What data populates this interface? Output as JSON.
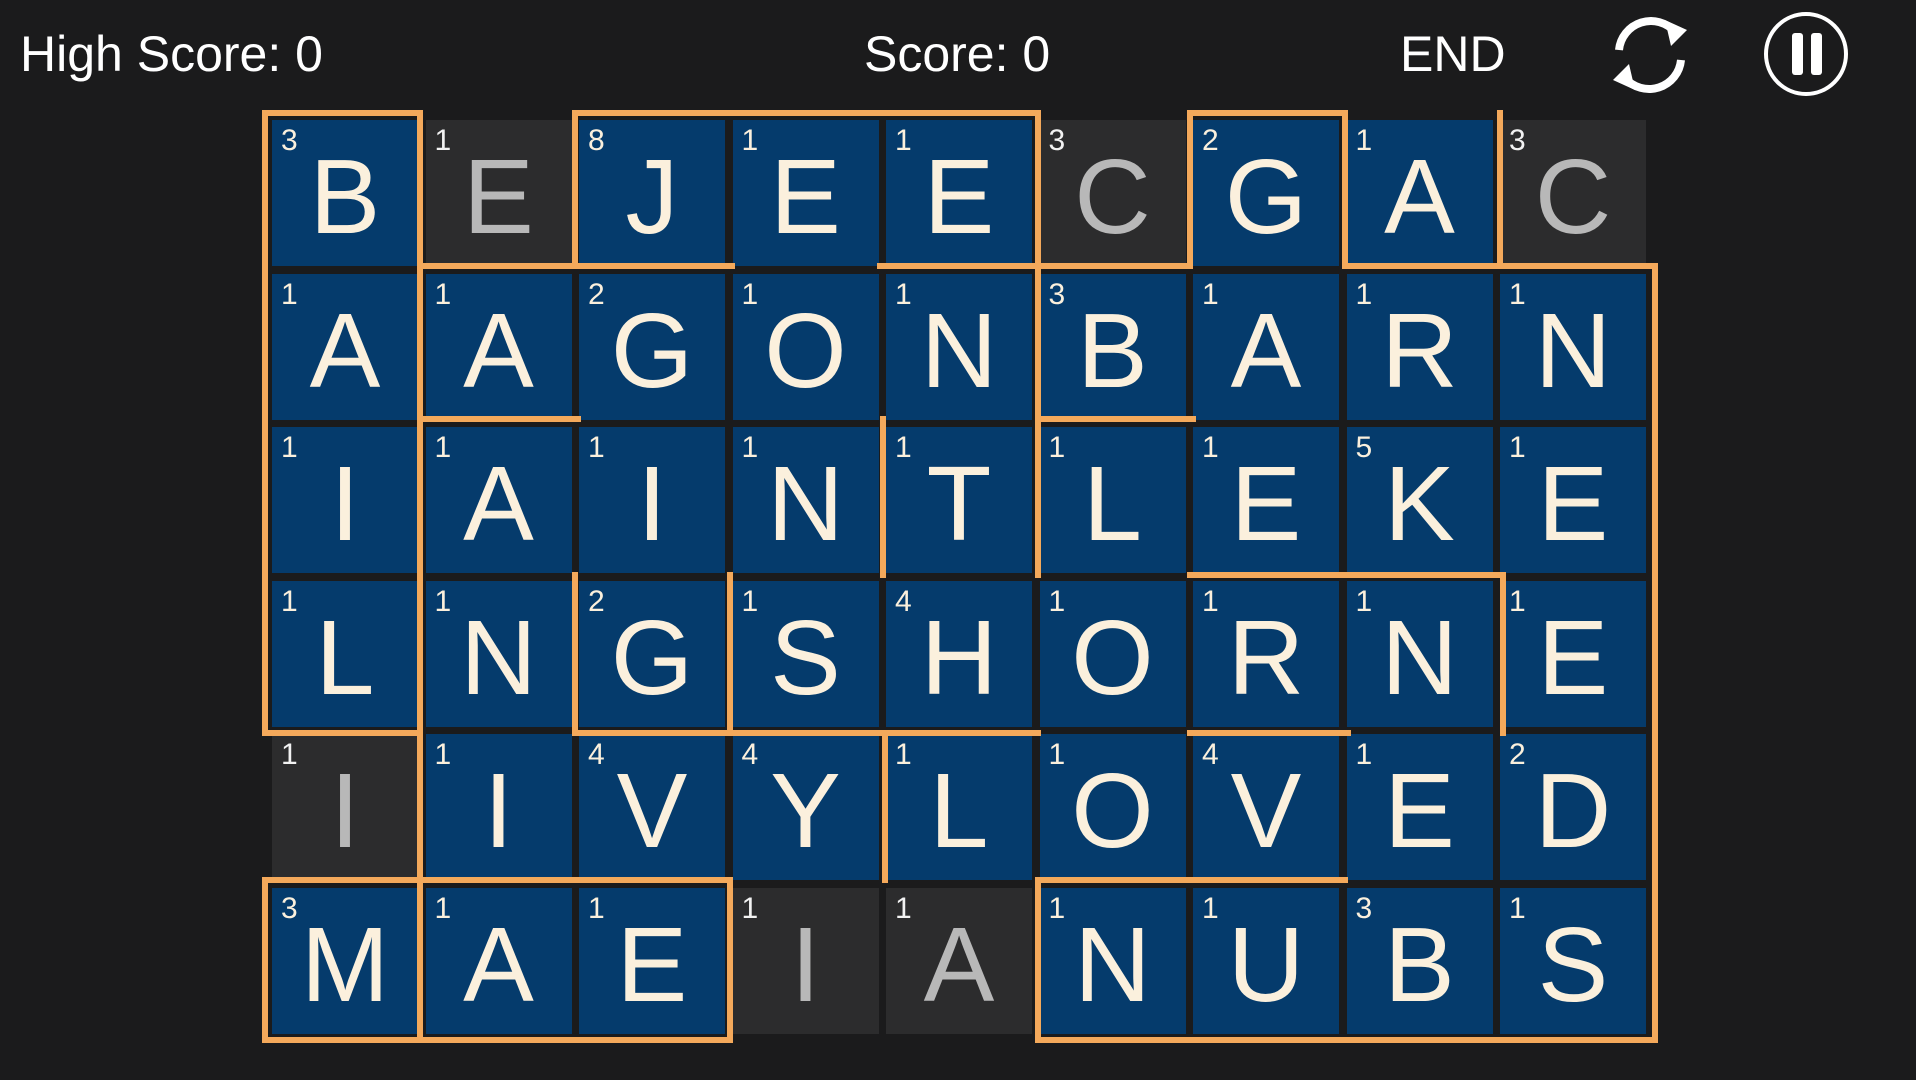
{
  "hud": {
    "high_score_label": "High Score: 0",
    "score_label": "Score: 0",
    "end_label": "END",
    "restart_icon": "restart-icon",
    "pause_icon": "pause-icon"
  },
  "colors": {
    "background": "#1b1b1c",
    "tile_blue": "#053b6c",
    "tile_dark": "#2c2c2d",
    "wall": "#f4a95b",
    "letter_light": "#fbf0dd",
    "letter_gray": "#b8b8b8"
  },
  "board": {
    "rows": [
      [
        {
          "letter": "B",
          "value": "3",
          "style": "blue"
        },
        {
          "letter": "E",
          "value": "1",
          "style": "dark"
        },
        {
          "letter": "J",
          "value": "8",
          "style": "blue"
        },
        {
          "letter": "E",
          "value": "1",
          "style": "blue"
        },
        {
          "letter": "E",
          "value": "1",
          "style": "blue"
        },
        {
          "letter": "C",
          "value": "3",
          "style": "dark"
        },
        {
          "letter": "G",
          "value": "2",
          "style": "blue"
        },
        {
          "letter": "A",
          "value": "1",
          "style": "blue"
        },
        {
          "letter": "C",
          "value": "3",
          "style": "dark"
        }
      ],
      [
        {
          "letter": "A",
          "value": "1",
          "style": "blue"
        },
        {
          "letter": "A",
          "value": "1",
          "style": "blue"
        },
        {
          "letter": "G",
          "value": "2",
          "style": "blue"
        },
        {
          "letter": "O",
          "value": "1",
          "style": "blue"
        },
        {
          "letter": "N",
          "value": "1",
          "style": "blue"
        },
        {
          "letter": "B",
          "value": "3",
          "style": "blue"
        },
        {
          "letter": "A",
          "value": "1",
          "style": "blue"
        },
        {
          "letter": "R",
          "value": "1",
          "style": "blue"
        },
        {
          "letter": "N",
          "value": "1",
          "style": "blue"
        }
      ],
      [
        {
          "letter": "I",
          "value": "1",
          "style": "blue"
        },
        {
          "letter": "A",
          "value": "1",
          "style": "blue"
        },
        {
          "letter": "I",
          "value": "1",
          "style": "blue"
        },
        {
          "letter": "N",
          "value": "1",
          "style": "blue"
        },
        {
          "letter": "T",
          "value": "1",
          "style": "blue"
        },
        {
          "letter": "L",
          "value": "1",
          "style": "blue"
        },
        {
          "letter": "E",
          "value": "1",
          "style": "blue"
        },
        {
          "letter": "K",
          "value": "5",
          "style": "blue"
        },
        {
          "letter": "E",
          "value": "1",
          "style": "blue"
        }
      ],
      [
        {
          "letter": "L",
          "value": "1",
          "style": "blue"
        },
        {
          "letter": "N",
          "value": "1",
          "style": "blue"
        },
        {
          "letter": "G",
          "value": "2",
          "style": "blue"
        },
        {
          "letter": "S",
          "value": "1",
          "style": "blue"
        },
        {
          "letter": "H",
          "value": "4",
          "style": "blue"
        },
        {
          "letter": "O",
          "value": "1",
          "style": "blue"
        },
        {
          "letter": "R",
          "value": "1",
          "style": "blue"
        },
        {
          "letter": "N",
          "value": "1",
          "style": "blue"
        },
        {
          "letter": "E",
          "value": "1",
          "style": "blue"
        }
      ],
      [
        {
          "letter": "I",
          "value": "1",
          "style": "dark"
        },
        {
          "letter": "I",
          "value": "1",
          "style": "blue"
        },
        {
          "letter": "V",
          "value": "4",
          "style": "blue"
        },
        {
          "letter": "Y",
          "value": "4",
          "style": "blue"
        },
        {
          "letter": "L",
          "value": "1",
          "style": "blue"
        },
        {
          "letter": "O",
          "value": "1",
          "style": "blue"
        },
        {
          "letter": "V",
          "value": "4",
          "style": "blue"
        },
        {
          "letter": "E",
          "value": "1",
          "style": "blue"
        },
        {
          "letter": "D",
          "value": "2",
          "style": "blue"
        }
      ],
      [
        {
          "letter": "M",
          "value": "3",
          "style": "blue"
        },
        {
          "letter": "A",
          "value": "1",
          "style": "blue"
        },
        {
          "letter": "E",
          "value": "1",
          "style": "blue"
        },
        {
          "letter": "I",
          "value": "1",
          "style": "dark"
        },
        {
          "letter": "A",
          "value": "1",
          "style": "dark"
        },
        {
          "letter": "N",
          "value": "1",
          "style": "blue"
        },
        {
          "letter": "U",
          "value": "1",
          "style": "blue"
        },
        {
          "letter": "B",
          "value": "3",
          "style": "blue"
        },
        {
          "letter": "S",
          "value": "1",
          "style": "blue"
        }
      ]
    ]
  }
}
